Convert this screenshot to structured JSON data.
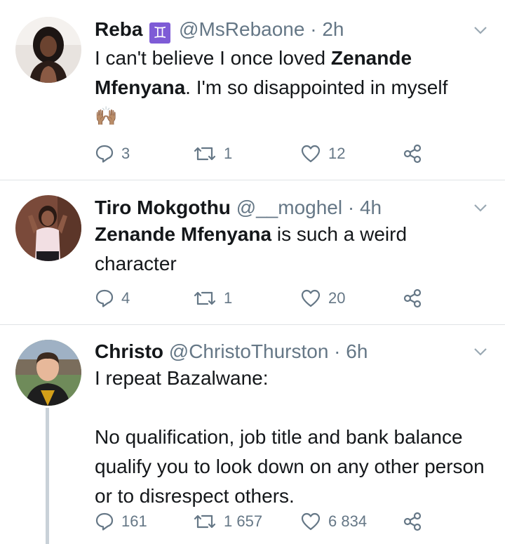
{
  "tweets": [
    {
      "name": "Reba",
      "badge": "♊",
      "handle": "@MsRebaone",
      "separator": "·",
      "time": "2h",
      "body_pre": "I can't believe I once loved ",
      "body_bold": "Zenande Mfenyana",
      "body_post": ". I'm so disappointed in myself",
      "emoji": "🙌🏽",
      "replies": "3",
      "retweets": "1",
      "likes": "12"
    },
    {
      "name": "Tiro Mokgothu",
      "handle": "@__moghel",
      "separator": "·",
      "time": "4h",
      "body_bold": "Zenande Mfenyana",
      "body_post": " is such a weird character",
      "replies": "4",
      "retweets": "1",
      "likes": "20"
    },
    {
      "name": "Christo",
      "handle": "@ChristoThurston",
      "separator": "·",
      "time": "6h",
      "body_line1": "I repeat Bazalwane:",
      "body_line2": "No qualification, job title and bank balance qualify you to look down on any other person or to disrespect others.",
      "replies": "161",
      "retweets": "1 657",
      "likes": "6 834"
    }
  ],
  "icons": {
    "reply": "reply-icon",
    "retweet": "retweet-icon",
    "like": "heart-icon",
    "share": "share-icon",
    "caret": "chevron-down-icon"
  },
  "colors": {
    "text": "#14171a",
    "muted": "#657786",
    "divider": "#dfe3e6",
    "badge": "#7e5bd6",
    "thread_line": "#c9d1d8"
  }
}
